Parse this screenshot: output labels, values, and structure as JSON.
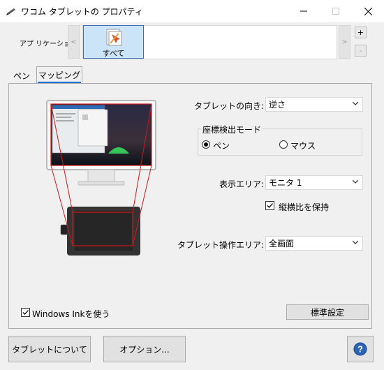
{
  "window": {
    "title": "ワコム タブレットの プロパティ",
    "controls": {
      "minimize": "—",
      "maximize": "☐",
      "close": "✕"
    }
  },
  "app_bar": {
    "label": "アプ リケーション:",
    "prev_arrow": "<",
    "next_arrow": ">",
    "items": [
      {
        "label": "すべて",
        "selected": true
      }
    ],
    "add_button": "+",
    "remove_button": "-"
  },
  "tabs": [
    {
      "label": "ペン",
      "active": false
    },
    {
      "label": "マッピング",
      "active": true
    }
  ],
  "mapping": {
    "orientation": {
      "label": "タブレットの向き:",
      "value": "逆さ"
    },
    "mode_group": {
      "title": "座標検出モード",
      "options": [
        {
          "label": "ペン",
          "selected": true
        },
        {
          "label": "マウス",
          "selected": false
        }
      ]
    },
    "display_area": {
      "label": "表示エリア:",
      "value": "モニタ 1"
    },
    "aspect_ratio": {
      "label": "縦横比を保持",
      "checked": true
    },
    "tablet_area": {
      "label": "タブレット操作エリア:",
      "value": "全画面"
    },
    "windows_ink": {
      "label": "Windows Inkを使う",
      "checked": true
    },
    "default_button": "標準設定"
  },
  "footer": {
    "about_button": "タブレットについて",
    "options_button": "オプション...",
    "help_button": "?"
  },
  "colors": {
    "accent_blue": "#1e6fd0",
    "mapping_red": "#d01818",
    "selection_bg": "#cce4f7",
    "help_blue": "#2a62b8"
  }
}
